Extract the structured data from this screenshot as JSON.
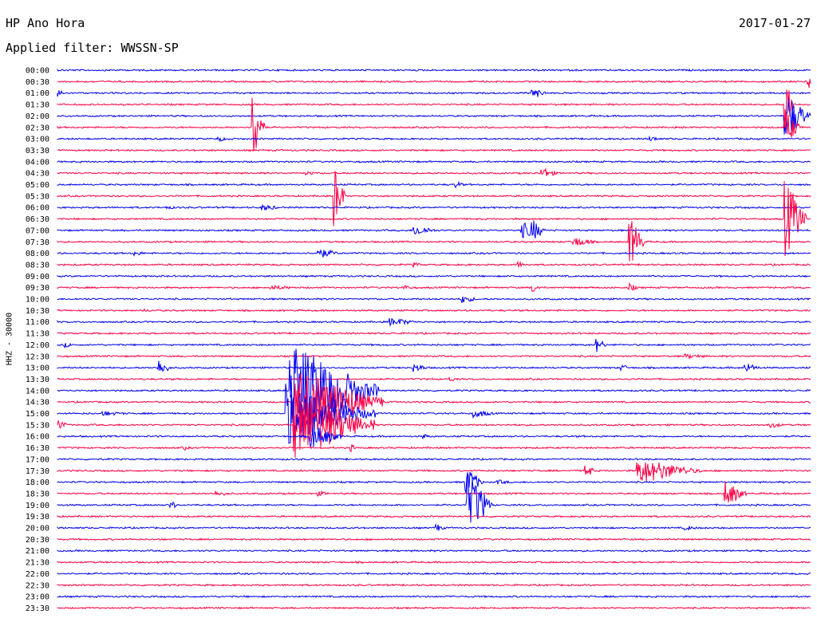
{
  "header": {
    "station_title": "HP Ano Hora",
    "date": "2017-01-27",
    "filter_label": "Applied filter: WWSSN-SP"
  },
  "channel_label": "HHZ - 30000",
  "colors": {
    "even_trace": "#0000ee",
    "odd_trace": "#ff0044"
  },
  "time_labels": [
    "00:00",
    "00:30",
    "01:00",
    "01:30",
    "02:00",
    "02:30",
    "03:00",
    "03:30",
    "04:00",
    "04:30",
    "05:00",
    "05:30",
    "06:00",
    "06:30",
    "07:00",
    "07:30",
    "08:00",
    "08:30",
    "09:00",
    "09:30",
    "10:00",
    "10:30",
    "11:00",
    "11:30",
    "12:00",
    "12:30",
    "13:00",
    "13:30",
    "14:00",
    "14:30",
    "15:00",
    "15:30",
    "16:00",
    "16:30",
    "17:00",
    "17:30",
    "18:00",
    "18:30",
    "19:00",
    "19:30",
    "20:00",
    "20:30",
    "21:00",
    "21:30",
    "22:00",
    "22:30",
    "23:00",
    "23:30"
  ]
}
